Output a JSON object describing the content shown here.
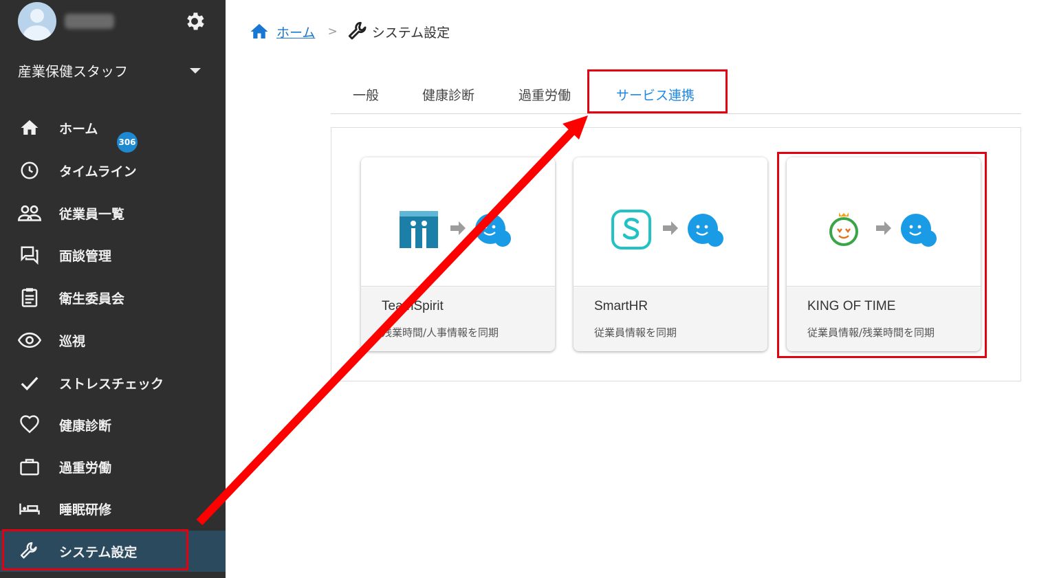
{
  "sidebar": {
    "role": "産業保健スタッフ",
    "items": [
      {
        "label": "ホーム",
        "icon": "home-icon"
      },
      {
        "label": "タイムライン",
        "icon": "clock-icon"
      },
      {
        "label": "従業員一覧",
        "icon": "people-icon"
      },
      {
        "label": "面談管理",
        "icon": "chat-icon",
        "badge": "306"
      },
      {
        "label": "衛生委員会",
        "icon": "clipboard-icon"
      },
      {
        "label": "巡視",
        "icon": "eye-icon"
      },
      {
        "label": "ストレスチェック",
        "icon": "check-icon"
      },
      {
        "label": "健康診断",
        "icon": "heart-icon"
      },
      {
        "label": "過重労働",
        "icon": "briefcase-icon"
      },
      {
        "label": "睡眠研修",
        "icon": "bed-icon"
      },
      {
        "label": "システム設定",
        "icon": "wrench-icon"
      }
    ]
  },
  "breadcrumb": {
    "home": "ホーム",
    "separator": ">",
    "current": "システム設定"
  },
  "tabs": [
    "一般",
    "健康診断",
    "過重労働",
    "サービス連携"
  ],
  "cards": [
    {
      "title": "TeamSpirit",
      "desc": "残業時間/人事情報を同期"
    },
    {
      "title": "SmartHR",
      "desc": "従業員情報を同期"
    },
    {
      "title": "KING OF TIME",
      "desc": "従業員情報/残業時間を同期"
    }
  ],
  "colors": {
    "sidebar_bg": "#2f2f2f",
    "active_bg": "#2b4a5e",
    "accent": "#1e88e5",
    "highlight": "#e3000f"
  }
}
